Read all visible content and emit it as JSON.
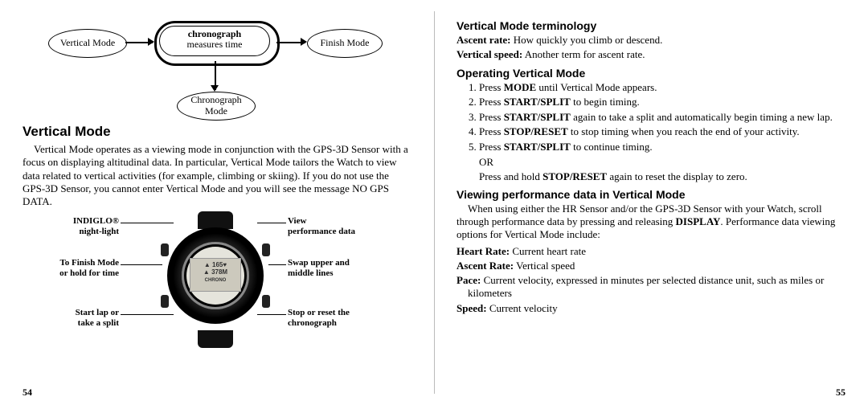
{
  "left": {
    "diagram": {
      "left_node": "Vertical Mode",
      "center_top": "chronograph",
      "center_sub": "measures time",
      "right_node": "Finish Mode",
      "bottom_node": "Chronograph\nMode"
    },
    "heading": "Vertical Mode",
    "para": "Vertical Mode operates as a viewing mode in conjunction with the GPS-3D Sensor with a focus on displaying altitudinal data. In particular, Vertical Mode tailors the Watch to view data related to vertical activities (for example, climbing or skiing). If you do not use the GPS-3D Sensor, you cannot enter Vertical Mode and you will see the message NO GPS DATA.",
    "captions": {
      "tl1": "INDIGLO®",
      "tl2": "night-light",
      "ml1": "To Finish Mode",
      "ml2": "or hold for time",
      "bl1": "Start lap or",
      "bl2": "take a split",
      "tr1": "View",
      "tr2": "performance data",
      "mr1": "Swap upper and",
      "mr2": "middle lines",
      "br1": "Stop or reset the",
      "br2": "chronograph"
    },
    "page": "54"
  },
  "right": {
    "h1": "Vertical Mode terminology",
    "def1_b": "Ascent rate:",
    "def1_t": " How quickly you climb or descend.",
    "def2_b": "Vertical speed:",
    "def2_t": " Another term for ascent rate.",
    "h2": "Operating Vertical Mode",
    "ol": {
      "i1a": "Press ",
      "i1b": "MODE",
      "i1c": " until Vertical Mode appears.",
      "i2a": "Press ",
      "i2b": "START/SPLIT",
      "i2c": " to begin timing.",
      "i3a": "Press ",
      "i3b": "START/SPLIT",
      "i3c": " again to take a split and automatically begin timing a new lap.",
      "i4a": "Press ",
      "i4b": "STOP/RESET",
      "i4c": " to stop timing when you reach the end of your activity.",
      "i5a": "Press ",
      "i5b": "START/SPLIT",
      "i5c": " to continue timing."
    },
    "or": "OR",
    "or_line_a": "Press and hold ",
    "or_line_b": "STOP/RESET",
    "or_line_c": " again to reset the display to zero.",
    "h3": "Viewing performance data in Vertical Mode",
    "p3a": "When using either the HR Sensor and/or the GPS-3D Sensor with your Watch, scroll through performance data by pressing and releasing ",
    "p3b": "DISPLAY",
    "p3c": ". Performance data viewing options for Vertical Mode include:",
    "d1b": "Heart Rate:",
    "d1t": " Current heart rate",
    "d2b": "Ascent Rate:",
    "d2t": " Vertical speed",
    "d3b": "Pace:",
    "d3t": " Current velocity, expressed in minutes per selected distance unit, such as miles or kilometers",
    "d4b": "Speed:",
    "d4t": " Current velocity",
    "page": "55"
  },
  "lcd": {
    "l1": "▲ 165♥",
    "l2": "▲ 378M",
    "l3": "CHRONO"
  }
}
